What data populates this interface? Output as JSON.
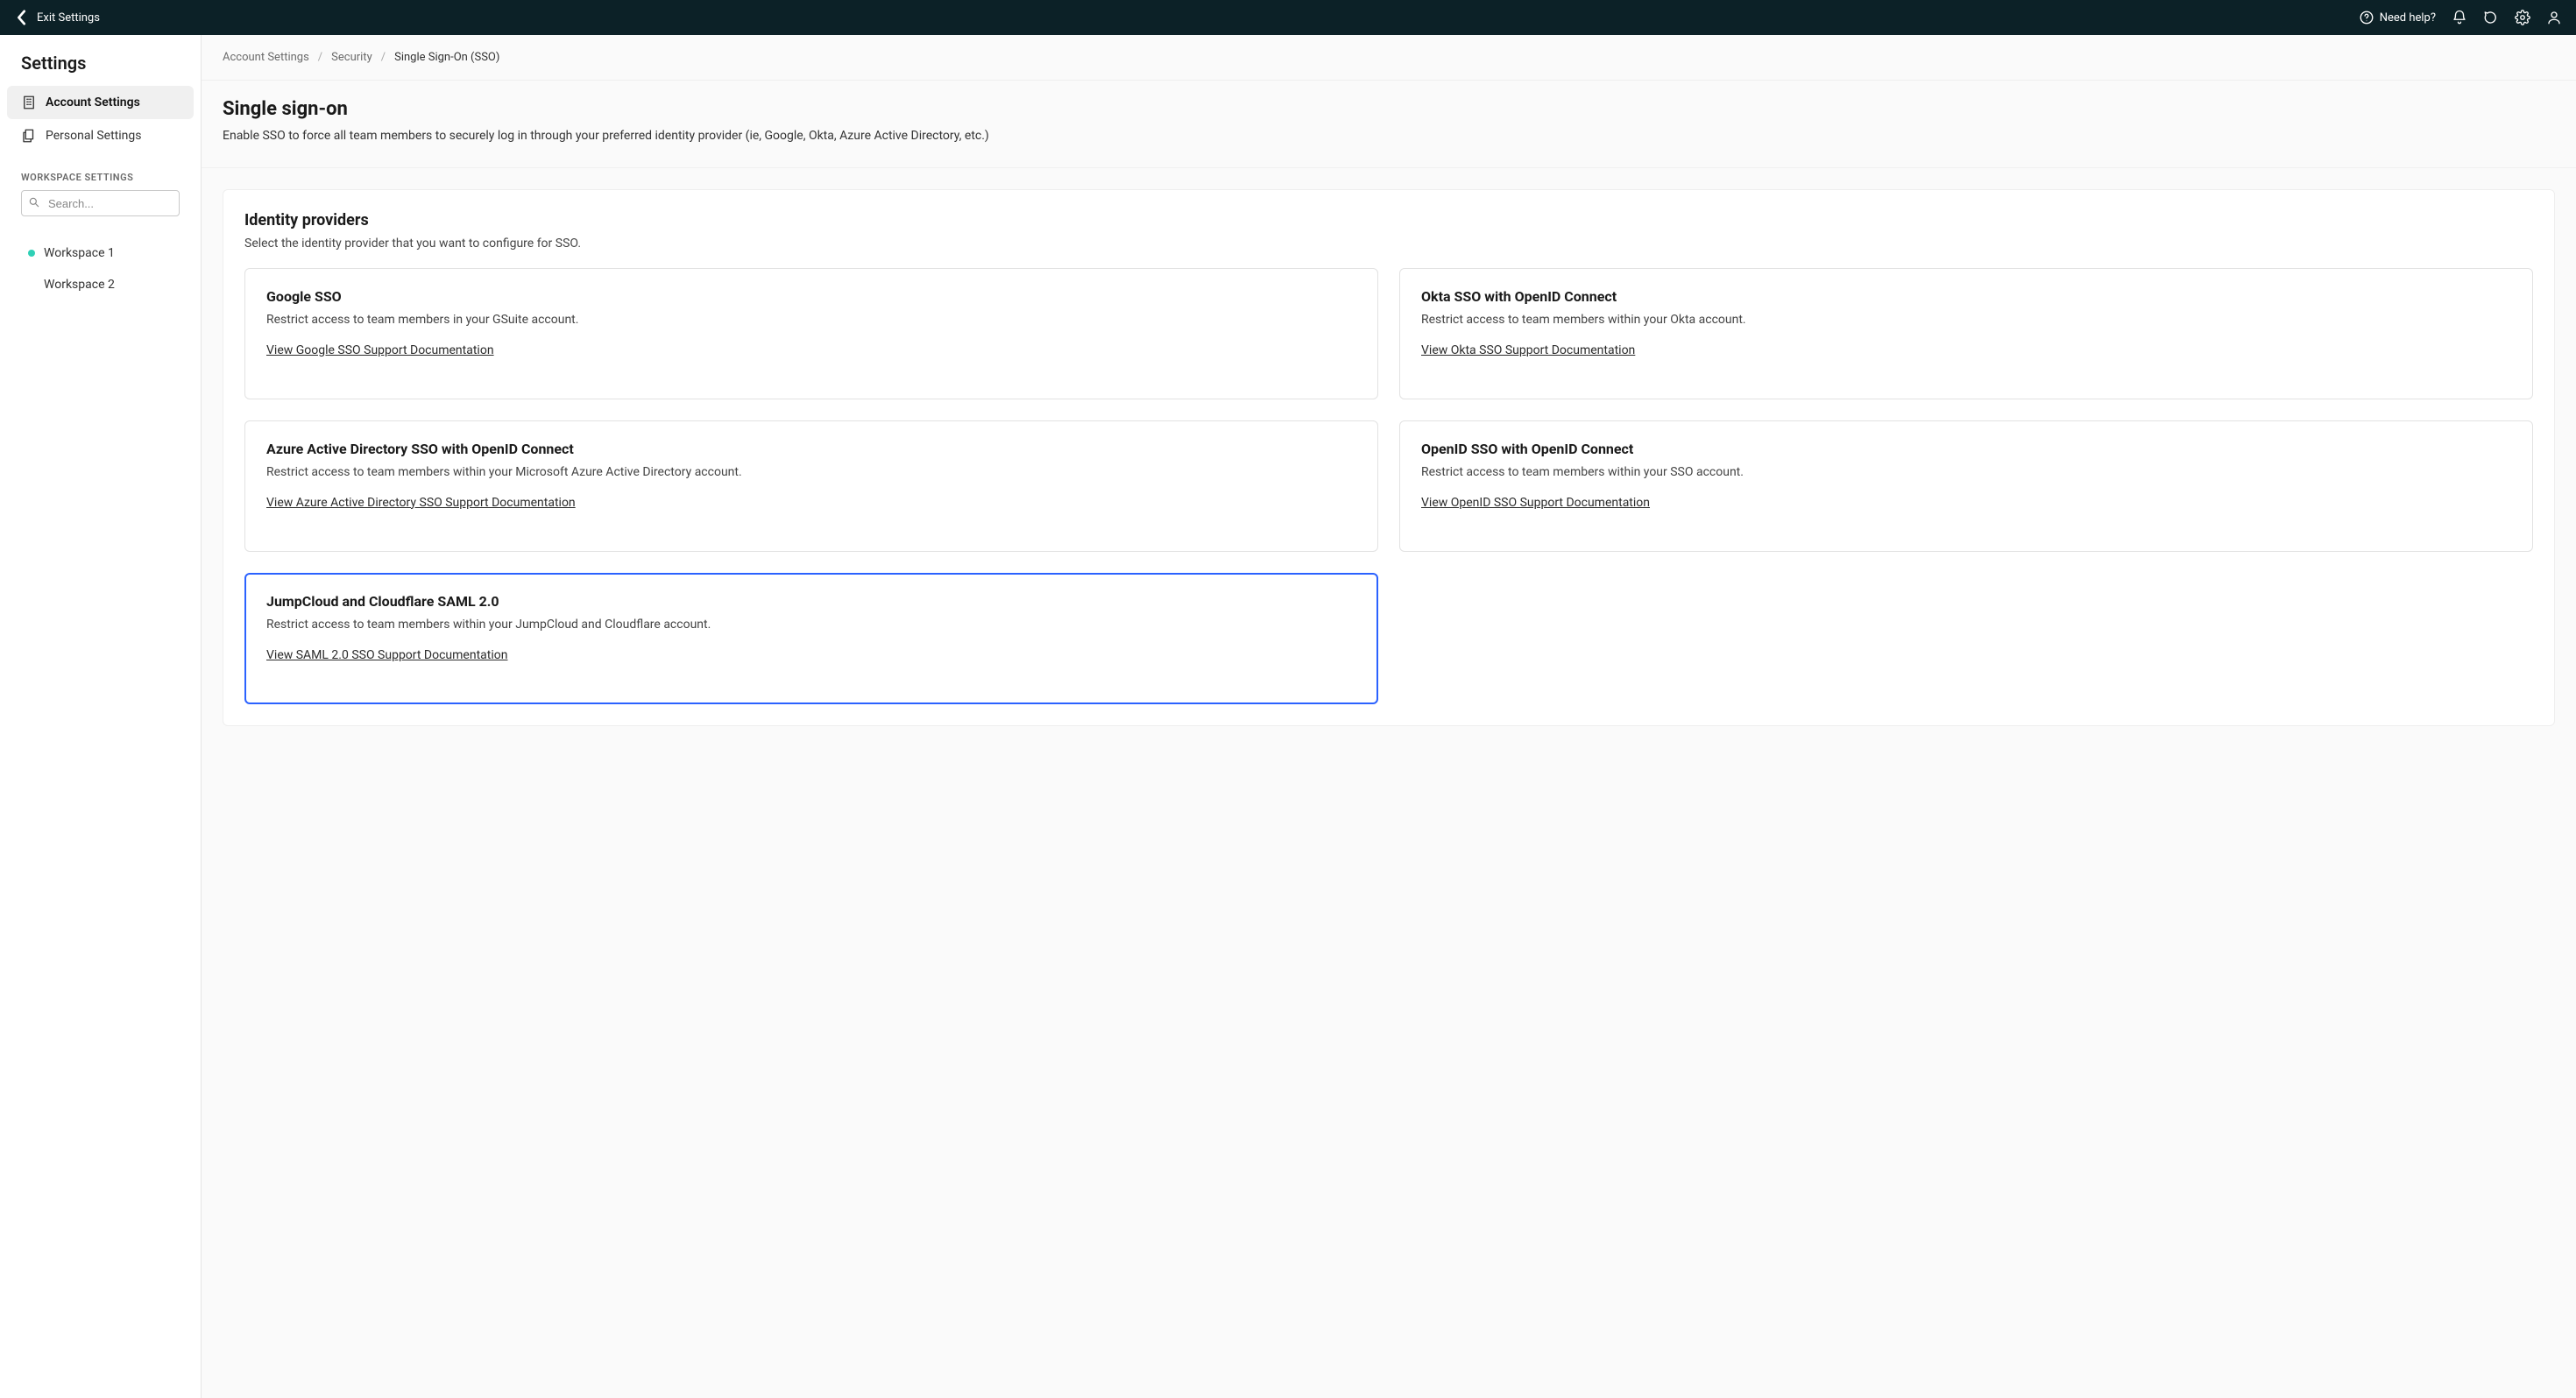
{
  "topbar": {
    "exit_label": "Exit Settings",
    "need_help_label": "Need help?"
  },
  "sidebar": {
    "title": "Settings",
    "items": [
      {
        "label": "Account Settings",
        "active": true
      },
      {
        "label": "Personal Settings",
        "active": false
      }
    ],
    "workspace_section_label": "WORKSPACE SETTINGS",
    "search_placeholder": "Search...",
    "workspaces": [
      {
        "label": "Workspace 1",
        "dot": "green"
      },
      {
        "label": "Workspace 2",
        "dot": "none"
      }
    ]
  },
  "breadcrumb": {
    "items": [
      "Account Settings",
      "Security",
      "Single Sign-On (SSO)"
    ]
  },
  "page": {
    "title": "Single sign-on",
    "description": "Enable SSO to force all team members to securely log in through your preferred identity provider (ie, Google, Okta, Azure Active Directory, etc.)"
  },
  "panel": {
    "title": "Identity providers",
    "description": "Select the identity provider that you want to configure for SSO."
  },
  "providers": [
    {
      "title": "Google SSO",
      "description": "Restrict access to team members in your GSuite account.",
      "link_label": "View Google SSO Support Documentation",
      "selected": false
    },
    {
      "title": "Okta SSO with OpenID Connect",
      "description": "Restrict access to team members within your Okta account.",
      "link_label": "View Okta SSO Support Documentation",
      "selected": false
    },
    {
      "title": "Azure Active Directory SSO with OpenID Connect",
      "description": "Restrict access to team members within your Microsoft Azure Active Directory account.",
      "link_label": "View Azure Active Directory SSO Support Documentation",
      "selected": false
    },
    {
      "title": "OpenID SSO with OpenID Connect",
      "description": "Restrict access to team members within your SSO account.",
      "link_label": "View OpenID SSO Support Documentation",
      "selected": false
    },
    {
      "title": "JumpCloud and Cloudflare SAML 2.0",
      "description": "Restrict access to team members within your JumpCloud and Cloudflare account.",
      "link_label": "View SAML 2.0 SSO Support Documentation",
      "selected": true
    }
  ]
}
